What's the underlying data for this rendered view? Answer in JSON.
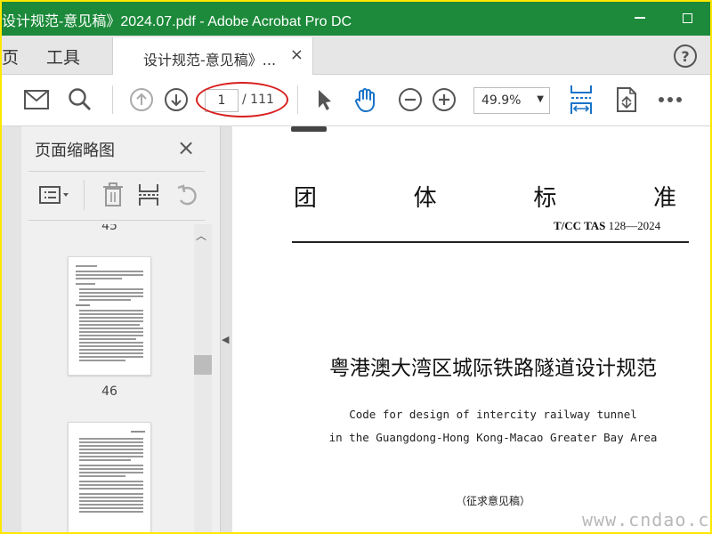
{
  "window": {
    "title": "设计规范-意见稿》2024.07.pdf - Adobe Acrobat Pro DC"
  },
  "tabs": {
    "home_partial": "页",
    "tools": "工具",
    "document": "设计规范-意见稿》...",
    "close": "×",
    "help": "?"
  },
  "toolbar": {
    "page_current": "1",
    "page_total": "/ 111",
    "zoom": "49.9%"
  },
  "thumbnail_panel": {
    "title": "页面缩略图",
    "close": "×",
    "top_partial_number": "45",
    "thumbnails": [
      {
        "page": "46"
      }
    ]
  },
  "document": {
    "heading_chars": [
      "团",
      "体",
      "标",
      "准"
    ],
    "standard_prefix": "T/CC TAS",
    "standard_number": "128—2024",
    "title_cn": "粤港澳大湾区城际铁路隧道设计规范",
    "title_en_line1": "Code for design of intercity railway tunnel",
    "title_en_line2": "in the Guangdong-Hong Kong-Macao Greater Bay Area",
    "draft_note": "（征求意见稿）"
  },
  "watermark": "www.cndao.com",
  "colors": {
    "titlebar": "#1c8a3a",
    "accent_blue": "#1a73c8",
    "annotation_red": "#d81e1e",
    "outer_border": "#ffe800"
  },
  "icons": {
    "toolbar": [
      "mail-icon",
      "search-icon",
      "page-up-icon",
      "page-down-icon",
      "select-cursor-icon",
      "hand-tool-icon",
      "zoom-out-icon",
      "zoom-in-icon",
      "fit-width-icon",
      "rotate-page-icon",
      "more-icon"
    ],
    "panel": [
      "options-menu-icon",
      "delete-icon",
      "insert-page-icon",
      "undo-icon"
    ]
  }
}
